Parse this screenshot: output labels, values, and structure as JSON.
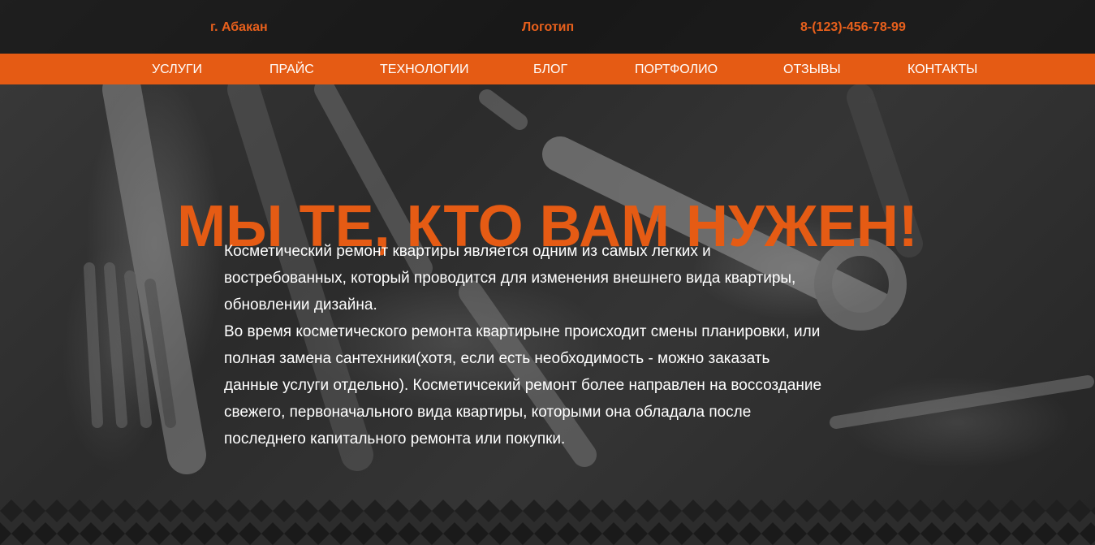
{
  "header": {
    "city": "г. Абакан",
    "logo": "Логотип",
    "phone": "8-(123)-456-78-99"
  },
  "nav": {
    "items": [
      {
        "label": "УСЛУГИ"
      },
      {
        "label": "ПРАЙС"
      },
      {
        "label": "ТЕХНОЛОГИИ"
      },
      {
        "label": "БЛОГ"
      },
      {
        "label": "ПОРТФОЛИО"
      },
      {
        "label": "ОТЗЫВЫ"
      },
      {
        "label": "КОНТАКТЫ"
      }
    ]
  },
  "hero": {
    "title": "МЫ ТЕ, КТО ВАМ НУЖЕН!",
    "lines": [
      "Косметический ремонт квартиры является одним из самых легких и",
      "востребованных, который проводится для изменения внешнего вида квартиры,",
      "обновлении дизайна.",
      "Во время косметического ремонта квартирыне происходит смены планировки, или",
      "полная замена сантехники(хотя, если есть необходимость - можно заказать",
      "данные услуги отдельно). Косметичсекий ремонт более направлен на воссоздание",
      "свежего, первоначального вида квартиры, которыми она обладала после",
      "последнего капитального ремонта или покупки."
    ]
  },
  "colors": {
    "accent": "#e55b14",
    "text_light": "#ffffff",
    "background": "#2a2a2a"
  }
}
